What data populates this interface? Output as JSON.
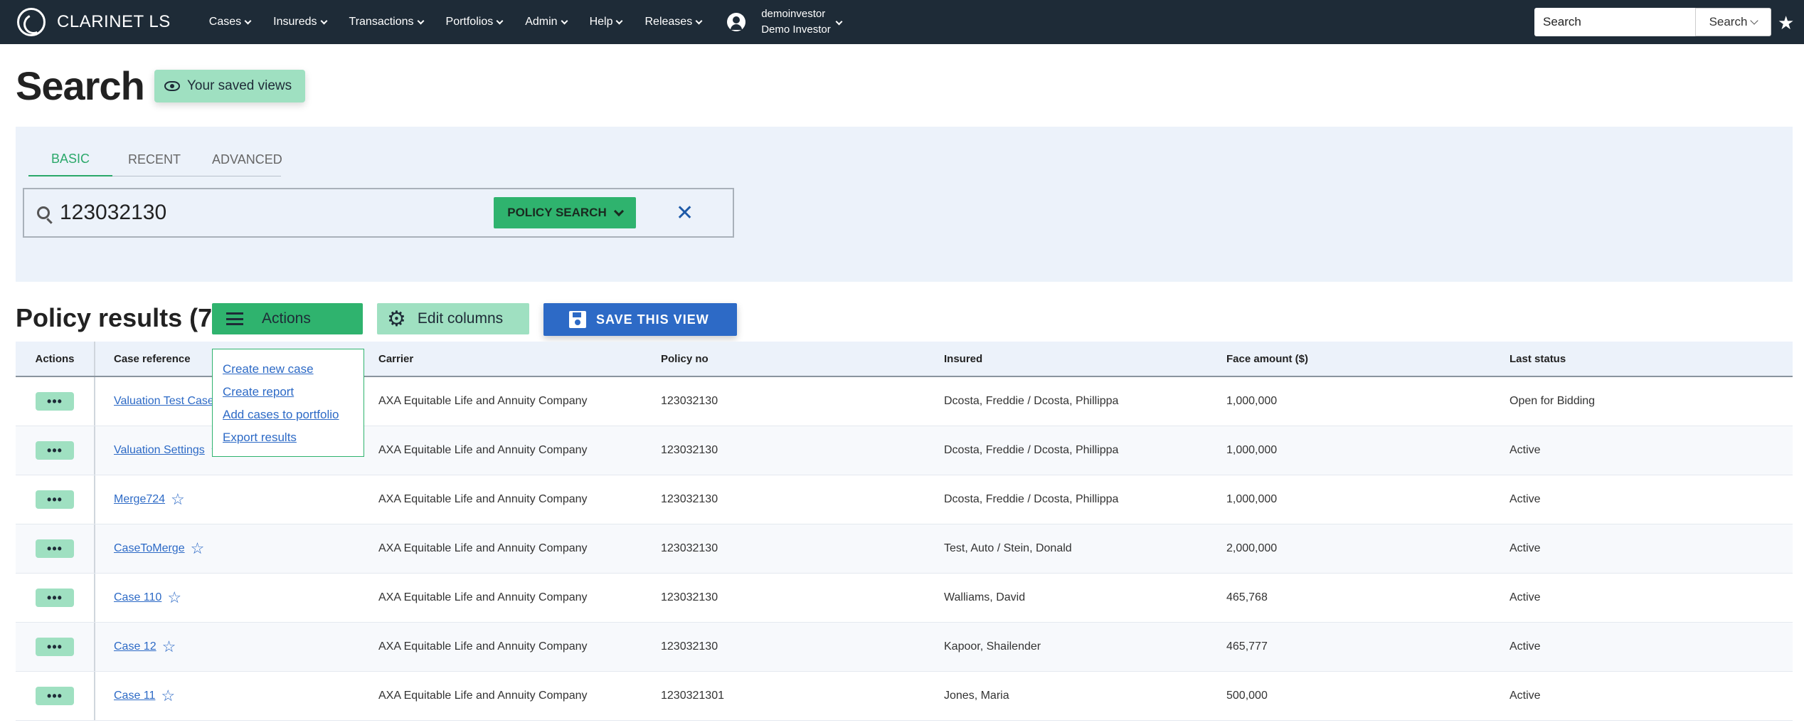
{
  "navbar": {
    "brand": "CLARINET LS",
    "menu": [
      {
        "label": "Cases"
      },
      {
        "label": "Insureds"
      },
      {
        "label": "Transactions"
      },
      {
        "label": "Portfolios"
      },
      {
        "label": "Admin"
      },
      {
        "label": "Help"
      },
      {
        "label": "Releases"
      }
    ],
    "user": {
      "username": "demoinvestor",
      "display_name": "Demo Investor"
    },
    "search_placeholder": "Search",
    "search_button": "Search",
    "icons": {
      "logo": "clarinet-logo-icon",
      "user": "user-circle-icon",
      "favorites": "star-icon"
    }
  },
  "header": {
    "title": "Search",
    "saved_views": "Your saved views"
  },
  "search_panel": {
    "tabs": [
      {
        "label": "BASIC",
        "active": true
      },
      {
        "label": "RECENT",
        "active": false
      },
      {
        "label": "ADVANCED",
        "active": false
      }
    ],
    "query": "123032130",
    "search_type": "POLICY SEARCH"
  },
  "results": {
    "title": "Policy results (7)",
    "actions_label": "Actions",
    "edit_columns_label": "Edit columns",
    "save_view_label": "SAVE THIS VIEW",
    "actions_menu": [
      "Create new case",
      "Create report",
      "Add cases to portfolio",
      "Export results"
    ],
    "columns": [
      "Actions",
      "Case reference",
      "Carrier",
      "Policy no",
      "Insured",
      "Face amount ($)",
      "Last status"
    ],
    "rows": [
      {
        "case": "Valuation Test Case",
        "carrier": "AXA Equitable Life and Annuity Company",
        "policy": "123032130",
        "insured": "Dcosta, Freddie / Dcosta, Phillippa",
        "face": "1,000,000",
        "status": "Open for Bidding"
      },
      {
        "case": "Valuation Settings",
        "carrier": "AXA Equitable Life and Annuity Company",
        "policy": "123032130",
        "insured": "Dcosta, Freddie / Dcosta, Phillippa",
        "face": "1,000,000",
        "status": "Active"
      },
      {
        "case": "Merge724",
        "carrier": "AXA Equitable Life and Annuity Company",
        "policy": "123032130",
        "insured": "Dcosta, Freddie / Dcosta, Phillippa",
        "face": "1,000,000",
        "status": "Active"
      },
      {
        "case": "CaseToMerge",
        "carrier": "AXA Equitable Life and Annuity Company",
        "policy": "123032130",
        "insured": "Test, Auto / Stein, Donald",
        "face": "2,000,000",
        "status": "Active"
      },
      {
        "case": "Case 110",
        "carrier": "AXA Equitable Life and Annuity Company",
        "policy": "123032130",
        "insured": "Walliams, David",
        "face": "465,768",
        "status": "Active"
      },
      {
        "case": "Case 12",
        "carrier": "AXA Equitable Life and Annuity Company",
        "policy": "123032130",
        "insured": "Kapoor, Shailender",
        "face": "465,777",
        "status": "Active"
      },
      {
        "case": "Case 11",
        "carrier": "AXA Equitable Life and Annuity Company",
        "policy": "1230321301",
        "insured": "Jones, Maria",
        "face": "500,000",
        "status": "Active"
      }
    ]
  },
  "colors": {
    "navbar": "#1e2b37",
    "primary_green": "#2fb36e",
    "light_green": "#9fe0c1",
    "blue": "#2d6ac6",
    "panel_bg": "#ecf2fa"
  }
}
